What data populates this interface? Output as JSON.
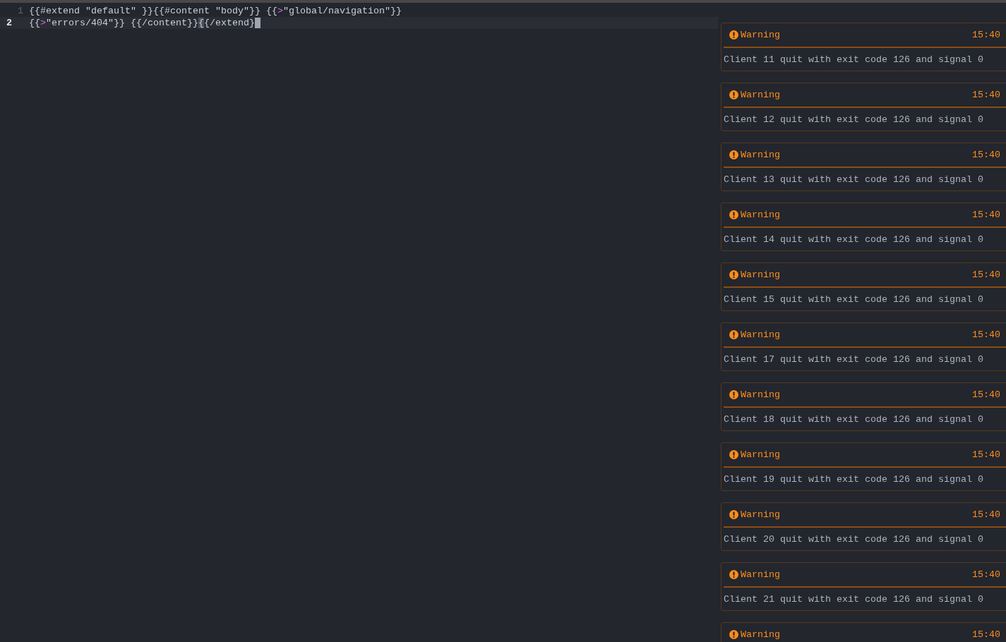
{
  "editor": {
    "lines": [
      {
        "number": "1",
        "current": false,
        "cursor": false,
        "tokens": [
          {
            "kind": "plain",
            "text": "{{#extend \"default\" }}{{#content \"body\"}} {{"
          },
          {
            "kind": "operator",
            "text": ">"
          },
          {
            "kind": "plain",
            "text": "\"global/navigation\"}}"
          }
        ]
      },
      {
        "number": "2",
        "current": true,
        "cursor": true,
        "tokens": [
          {
            "kind": "plain",
            "text": "{{"
          },
          {
            "kind": "operator",
            "text": ">"
          },
          {
            "kind": "plain",
            "text": "\"errors/404\"}} {{/content}}"
          },
          {
            "kind": "match",
            "text": "{"
          },
          {
            "kind": "plain",
            "text": "{/extend}"
          }
        ]
      }
    ]
  },
  "notifications": [
    {
      "kind": "warning",
      "title": "Warning",
      "time": "15:40",
      "message": "Client 11 quit with exit code 126 and signal 0"
    },
    {
      "kind": "warning",
      "title": "Warning",
      "time": "15:40",
      "message": "Client 12 quit with exit code 126 and signal 0"
    },
    {
      "kind": "warning",
      "title": "Warning",
      "time": "15:40",
      "message": "Client 13 quit with exit code 126 and signal 0"
    },
    {
      "kind": "warning",
      "title": "Warning",
      "time": "15:40",
      "message": "Client 14 quit with exit code 126 and signal 0"
    },
    {
      "kind": "warning",
      "title": "Warning",
      "time": "15:40",
      "message": "Client 15 quit with exit code 126 and signal 0"
    },
    {
      "kind": "warning",
      "title": "Warning",
      "time": "15:40",
      "message": "Client 17 quit with exit code 126 and signal 0"
    },
    {
      "kind": "warning",
      "title": "Warning",
      "time": "15:40",
      "message": "Client 18 quit with exit code 126 and signal 0"
    },
    {
      "kind": "warning",
      "title": "Warning",
      "time": "15:40",
      "message": "Client 19 quit with exit code 126 and signal 0"
    },
    {
      "kind": "warning",
      "title": "Warning",
      "time": "15:40",
      "message": "Client 20 quit with exit code 126 and signal 0"
    },
    {
      "kind": "warning",
      "title": "Warning",
      "time": "15:40",
      "message": "Client 21 quit with exit code 126 and signal 0"
    },
    {
      "kind": "warning",
      "title": "Warning",
      "time": "15:40"
    }
  ]
}
